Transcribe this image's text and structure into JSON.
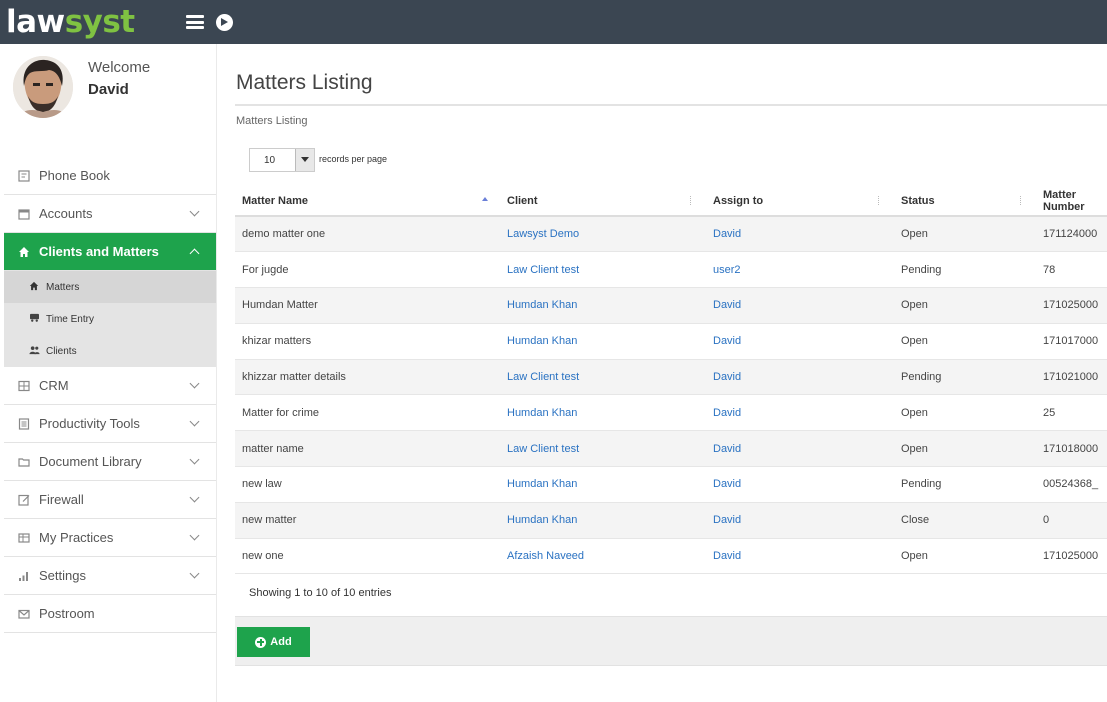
{
  "brand": {
    "logo_part1": "law",
    "logo_part2": "syst"
  },
  "user": {
    "welcome": "Welcome",
    "name": "David"
  },
  "sidebar": {
    "items": [
      {
        "label": "Phone Book"
      },
      {
        "label": "Accounts"
      },
      {
        "label": "Clients and Matters"
      },
      {
        "label": "CRM"
      },
      {
        "label": "Productivity Tools"
      },
      {
        "label": "Document Library"
      },
      {
        "label": "Firewall"
      },
      {
        "label": "My Practices"
      },
      {
        "label": "Settings"
      },
      {
        "label": "Postroom"
      }
    ],
    "sub_items": [
      {
        "label": "Matters"
      },
      {
        "label": "Time Entry"
      },
      {
        "label": "Clients"
      }
    ]
  },
  "main": {
    "title": "Matters Listing",
    "breadcrumb": "Matters Listing",
    "page_length": "10",
    "page_length_label": "records per page",
    "columns": [
      "Matter Name",
      "Client",
      "Assign to",
      "Status",
      "Matter Number"
    ],
    "rows": [
      {
        "name": "demo matter one",
        "client": "Lawsyst Demo",
        "assign": "David",
        "status": "Open",
        "number": "171124000"
      },
      {
        "name": "For jugde",
        "client": "Law Client test",
        "assign": "user2",
        "status": "Pending",
        "number": "78"
      },
      {
        "name": "Humdan Matter",
        "client": "Humdan Khan",
        "assign": "David",
        "status": "Open",
        "number": "171025000"
      },
      {
        "name": "khizar matters",
        "client": "Humdan Khan",
        "assign": "David",
        "status": "Open",
        "number": "171017000"
      },
      {
        "name": "khizzar matter details",
        "client": "Law Client test",
        "assign": "David",
        "status": "Pending",
        "number": "171021000"
      },
      {
        "name": "Matter for crime",
        "client": "Humdan Khan",
        "assign": "David",
        "status": "Open",
        "number": "25"
      },
      {
        "name": "matter name",
        "client": "Law Client test",
        "assign": "David",
        "status": "Open",
        "number": "171018000"
      },
      {
        "name": "new law",
        "client": "Humdan Khan",
        "assign": "David",
        "status": "Pending",
        "number": "00524368_"
      },
      {
        "name": "new matter",
        "client": "Humdan Khan",
        "assign": "David",
        "status": "Close",
        "number": "0"
      },
      {
        "name": "new one",
        "client": "Afzaish Naveed",
        "assign": "David",
        "status": "Open",
        "number": "171025000"
      }
    ],
    "info": "Showing 1 to 10 of 10 entries",
    "add_label": "Add"
  }
}
